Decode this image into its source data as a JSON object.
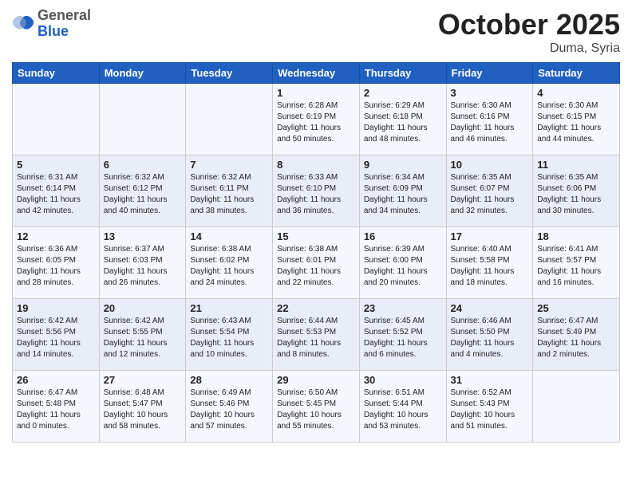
{
  "header": {
    "logo_general": "General",
    "logo_blue": "Blue",
    "month_title": "October 2025",
    "location": "Duma, Syria"
  },
  "weekdays": [
    "Sunday",
    "Monday",
    "Tuesday",
    "Wednesday",
    "Thursday",
    "Friday",
    "Saturday"
  ],
  "weeks": [
    [
      {
        "day": "",
        "sunrise": "",
        "sunset": "",
        "daylight": ""
      },
      {
        "day": "",
        "sunrise": "",
        "sunset": "",
        "daylight": ""
      },
      {
        "day": "",
        "sunrise": "",
        "sunset": "",
        "daylight": ""
      },
      {
        "day": "1",
        "sunrise": "Sunrise: 6:28 AM",
        "sunset": "Sunset: 6:19 PM",
        "daylight": "Daylight: 11 hours and 50 minutes."
      },
      {
        "day": "2",
        "sunrise": "Sunrise: 6:29 AM",
        "sunset": "Sunset: 6:18 PM",
        "daylight": "Daylight: 11 hours and 48 minutes."
      },
      {
        "day": "3",
        "sunrise": "Sunrise: 6:30 AM",
        "sunset": "Sunset: 6:16 PM",
        "daylight": "Daylight: 11 hours and 46 minutes."
      },
      {
        "day": "4",
        "sunrise": "Sunrise: 6:30 AM",
        "sunset": "Sunset: 6:15 PM",
        "daylight": "Daylight: 11 hours and 44 minutes."
      }
    ],
    [
      {
        "day": "5",
        "sunrise": "Sunrise: 6:31 AM",
        "sunset": "Sunset: 6:14 PM",
        "daylight": "Daylight: 11 hours and 42 minutes."
      },
      {
        "day": "6",
        "sunrise": "Sunrise: 6:32 AM",
        "sunset": "Sunset: 6:12 PM",
        "daylight": "Daylight: 11 hours and 40 minutes."
      },
      {
        "day": "7",
        "sunrise": "Sunrise: 6:32 AM",
        "sunset": "Sunset: 6:11 PM",
        "daylight": "Daylight: 11 hours and 38 minutes."
      },
      {
        "day": "8",
        "sunrise": "Sunrise: 6:33 AM",
        "sunset": "Sunset: 6:10 PM",
        "daylight": "Daylight: 11 hours and 36 minutes."
      },
      {
        "day": "9",
        "sunrise": "Sunrise: 6:34 AM",
        "sunset": "Sunset: 6:09 PM",
        "daylight": "Daylight: 11 hours and 34 minutes."
      },
      {
        "day": "10",
        "sunrise": "Sunrise: 6:35 AM",
        "sunset": "Sunset: 6:07 PM",
        "daylight": "Daylight: 11 hours and 32 minutes."
      },
      {
        "day": "11",
        "sunrise": "Sunrise: 6:35 AM",
        "sunset": "Sunset: 6:06 PM",
        "daylight": "Daylight: 11 hours and 30 minutes."
      }
    ],
    [
      {
        "day": "12",
        "sunrise": "Sunrise: 6:36 AM",
        "sunset": "Sunset: 6:05 PM",
        "daylight": "Daylight: 11 hours and 28 minutes."
      },
      {
        "day": "13",
        "sunrise": "Sunrise: 6:37 AM",
        "sunset": "Sunset: 6:03 PM",
        "daylight": "Daylight: 11 hours and 26 minutes."
      },
      {
        "day": "14",
        "sunrise": "Sunrise: 6:38 AM",
        "sunset": "Sunset: 6:02 PM",
        "daylight": "Daylight: 11 hours and 24 minutes."
      },
      {
        "day": "15",
        "sunrise": "Sunrise: 6:38 AM",
        "sunset": "Sunset: 6:01 PM",
        "daylight": "Daylight: 11 hours and 22 minutes."
      },
      {
        "day": "16",
        "sunrise": "Sunrise: 6:39 AM",
        "sunset": "Sunset: 6:00 PM",
        "daylight": "Daylight: 11 hours and 20 minutes."
      },
      {
        "day": "17",
        "sunrise": "Sunrise: 6:40 AM",
        "sunset": "Sunset: 5:58 PM",
        "daylight": "Daylight: 11 hours and 18 minutes."
      },
      {
        "day": "18",
        "sunrise": "Sunrise: 6:41 AM",
        "sunset": "Sunset: 5:57 PM",
        "daylight": "Daylight: 11 hours and 16 minutes."
      }
    ],
    [
      {
        "day": "19",
        "sunrise": "Sunrise: 6:42 AM",
        "sunset": "Sunset: 5:56 PM",
        "daylight": "Daylight: 11 hours and 14 minutes."
      },
      {
        "day": "20",
        "sunrise": "Sunrise: 6:42 AM",
        "sunset": "Sunset: 5:55 PM",
        "daylight": "Daylight: 11 hours and 12 minutes."
      },
      {
        "day": "21",
        "sunrise": "Sunrise: 6:43 AM",
        "sunset": "Sunset: 5:54 PM",
        "daylight": "Daylight: 11 hours and 10 minutes."
      },
      {
        "day": "22",
        "sunrise": "Sunrise: 6:44 AM",
        "sunset": "Sunset: 5:53 PM",
        "daylight": "Daylight: 11 hours and 8 minutes."
      },
      {
        "day": "23",
        "sunrise": "Sunrise: 6:45 AM",
        "sunset": "Sunset: 5:52 PM",
        "daylight": "Daylight: 11 hours and 6 minutes."
      },
      {
        "day": "24",
        "sunrise": "Sunrise: 6:46 AM",
        "sunset": "Sunset: 5:50 PM",
        "daylight": "Daylight: 11 hours and 4 minutes."
      },
      {
        "day": "25",
        "sunrise": "Sunrise: 6:47 AM",
        "sunset": "Sunset: 5:49 PM",
        "daylight": "Daylight: 11 hours and 2 minutes."
      }
    ],
    [
      {
        "day": "26",
        "sunrise": "Sunrise: 6:47 AM",
        "sunset": "Sunset: 5:48 PM",
        "daylight": "Daylight: 11 hours and 0 minutes."
      },
      {
        "day": "27",
        "sunrise": "Sunrise: 6:48 AM",
        "sunset": "Sunset: 5:47 PM",
        "daylight": "Daylight: 10 hours and 58 minutes."
      },
      {
        "day": "28",
        "sunrise": "Sunrise: 6:49 AM",
        "sunset": "Sunset: 5:46 PM",
        "daylight": "Daylight: 10 hours and 57 minutes."
      },
      {
        "day": "29",
        "sunrise": "Sunrise: 6:50 AM",
        "sunset": "Sunset: 5:45 PM",
        "daylight": "Daylight: 10 hours and 55 minutes."
      },
      {
        "day": "30",
        "sunrise": "Sunrise: 6:51 AM",
        "sunset": "Sunset: 5:44 PM",
        "daylight": "Daylight: 10 hours and 53 minutes."
      },
      {
        "day": "31",
        "sunrise": "Sunrise: 6:52 AM",
        "sunset": "Sunset: 5:43 PM",
        "daylight": "Daylight: 10 hours and 51 minutes."
      },
      {
        "day": "",
        "sunrise": "",
        "sunset": "",
        "daylight": ""
      }
    ]
  ]
}
